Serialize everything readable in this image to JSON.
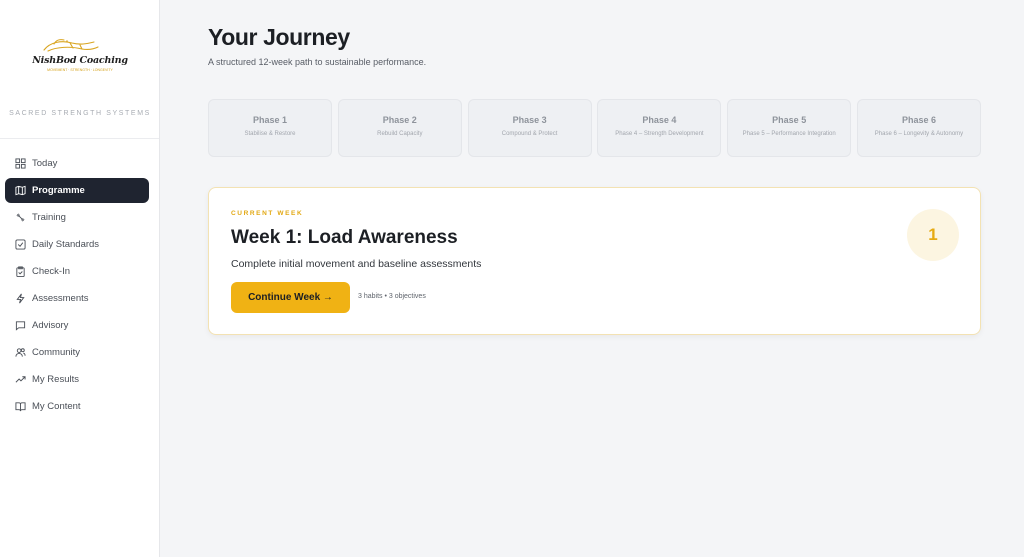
{
  "brand": {
    "name": "NishBod Coaching",
    "tagline": "MOVEMENT · STRENGTH · LONGEVITY",
    "subtitle": "SACRED STRENGTH SYSTEMS"
  },
  "nav": [
    {
      "label": "Today",
      "icon": "grid-icon",
      "active": false
    },
    {
      "label": "Programme",
      "icon": "map-icon",
      "active": true
    },
    {
      "label": "Training",
      "icon": "dumbbell-icon",
      "active": false
    },
    {
      "label": "Daily Standards",
      "icon": "checkbox-icon",
      "active": false
    },
    {
      "label": "Check-In",
      "icon": "clipboard-icon",
      "active": false
    },
    {
      "label": "Assessments",
      "icon": "bolt-icon",
      "active": false
    },
    {
      "label": "Advisory",
      "icon": "chat-icon",
      "active": false
    },
    {
      "label": "Community",
      "icon": "users-icon",
      "active": false
    },
    {
      "label": "My Results",
      "icon": "trend-icon",
      "active": false
    },
    {
      "label": "My Content",
      "icon": "book-icon",
      "active": false
    }
  ],
  "page": {
    "title": "Your Journey",
    "subtitle": "A structured 12-week path to sustainable performance."
  },
  "phases": [
    {
      "name": "Phase 1",
      "desc": "Stabilise & Restore"
    },
    {
      "name": "Phase 2",
      "desc": "Rebuild Capacity"
    },
    {
      "name": "Phase 3",
      "desc": "Compound & Protect"
    },
    {
      "name": "Phase 4",
      "desc": "Phase 4 – Strength Development"
    },
    {
      "name": "Phase 5",
      "desc": "Phase 5 – Performance Integration"
    },
    {
      "name": "Phase 6",
      "desc": "Phase 6 – Longevity & Autonomy"
    }
  ],
  "current_week": {
    "label": "CURRENT WEEK",
    "title": "Week 1: Load Awareness",
    "description": "Complete initial movement and baseline assessments",
    "button_label": "Continue Week →",
    "meta": "3 habits • 3 objectives",
    "number": "1"
  },
  "colors": {
    "accent": "#f0b214",
    "sidebar_active": "#1f2430",
    "background": "#f4f5f7"
  }
}
